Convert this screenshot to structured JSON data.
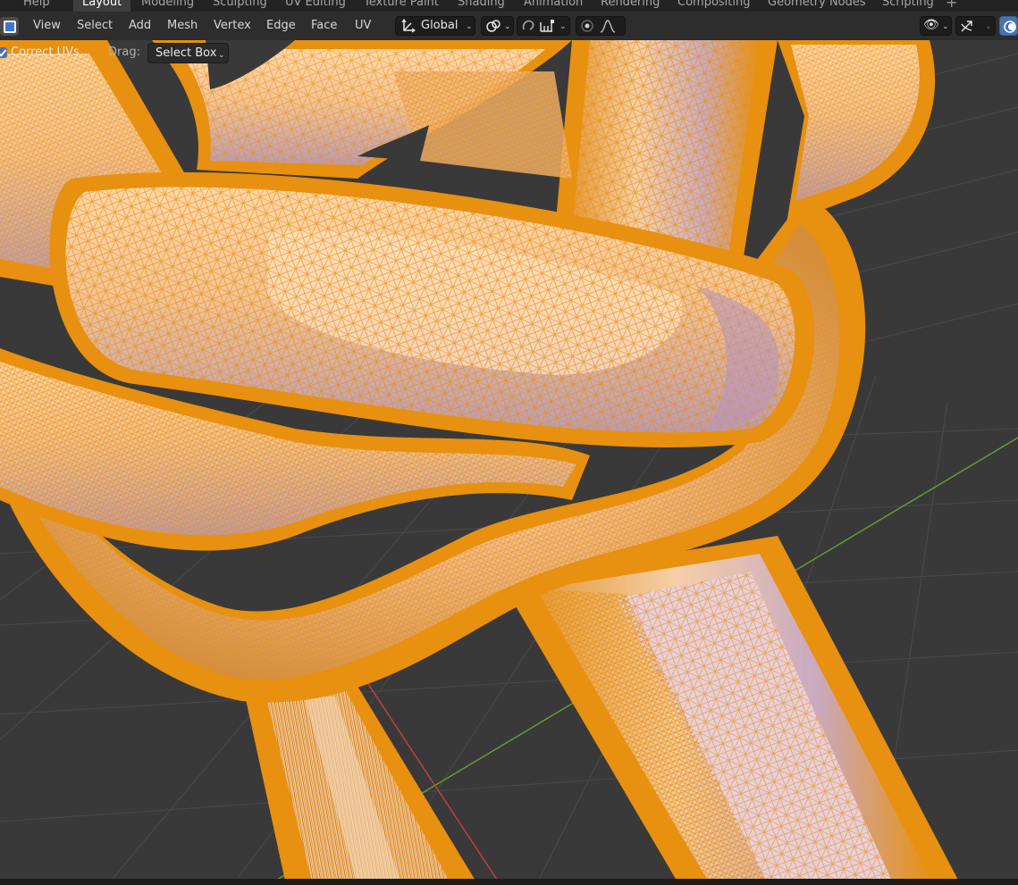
{
  "workspace_tabs": [
    {
      "label": "Help",
      "active": false
    },
    {
      "label": "Layout",
      "active": true
    },
    {
      "label": "Modeling",
      "active": false
    },
    {
      "label": "Sculpting",
      "active": false
    },
    {
      "label": "UV Editing",
      "active": false
    },
    {
      "label": "Texture Paint",
      "active": false
    },
    {
      "label": "Shading",
      "active": false
    },
    {
      "label": "Animation",
      "active": false
    },
    {
      "label": "Rendering",
      "active": false
    },
    {
      "label": "Compositing",
      "active": false
    },
    {
      "label": "Geometry Nodes",
      "active": false
    },
    {
      "label": "Scripting",
      "active": false
    }
  ],
  "add_workspace_symbol": "+",
  "header": {
    "editor_type_icon": "cube-icon",
    "menu": [
      "View",
      "Select",
      "Add",
      "Mesh",
      "Vertex",
      "Edge",
      "Face",
      "UV"
    ],
    "transform_orientation": "Global",
    "icons": [
      "transform-orientation-icon",
      "pivot-point-icon",
      "snap-icon",
      "snap-increment-icon",
      "proportional-edit-icon",
      "falloff-icon",
      "visibility-icon",
      "gizmo-icon",
      "overlay-icon"
    ]
  },
  "tool_settings": {
    "correct_uvs_label": "Correct UVs",
    "correct_uvs_checked": true,
    "drag_label": "Drag:",
    "drag_value": "Select Box"
  },
  "colors": {
    "wire": "#e8900f",
    "rope_base": "#e5b488",
    "rope_highlight": "#ffdcb4",
    "rope_shadow": "#a88fb0",
    "grid_bg": "#393939",
    "grid_line": "#4a4a4a",
    "axis_x": "#c8403f",
    "axis_y": "#6aa030",
    "accent": "#4772b3"
  }
}
